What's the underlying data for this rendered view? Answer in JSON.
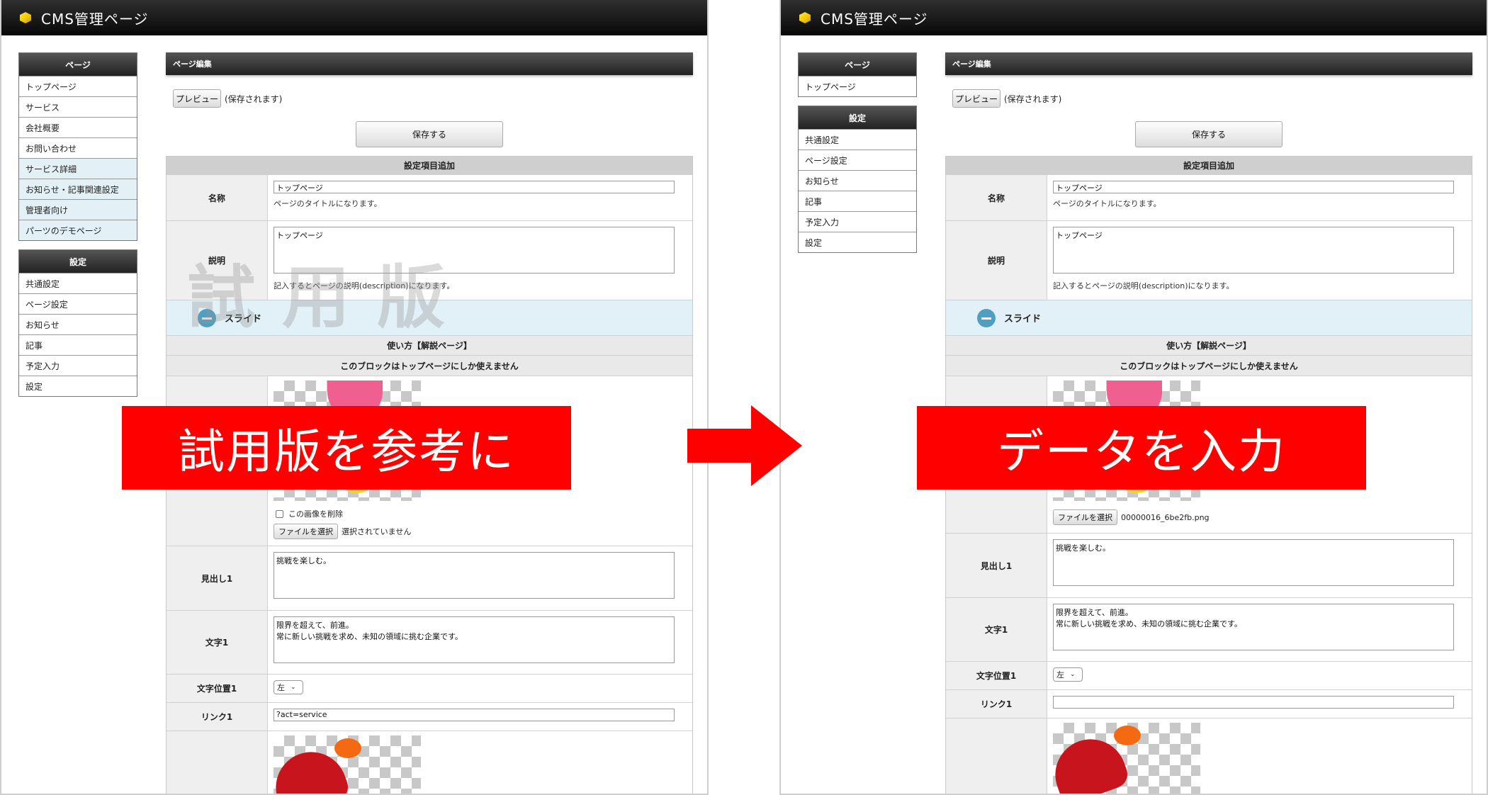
{
  "app_title": "CMS管理ページ",
  "sidebar": {
    "pages_header": "ページ",
    "pages_items_left": [
      "トップページ",
      "サービス",
      "会社概要",
      "お問い合わせ",
      "サービス詳細",
      "お知らせ・記事関連設定",
      "管理者向け",
      "パーツのデモページ"
    ],
    "pages_items_right": [
      "トップページ"
    ],
    "settings_header": "設定",
    "settings_items": [
      "共通設定",
      "ページ設定",
      "お知らせ",
      "記事",
      "予定入力",
      "設定"
    ]
  },
  "main": {
    "header": "ページ編集",
    "preview_button": "プレビュー",
    "preview_note": "(保存されます)",
    "save_button": "保存する",
    "section_title": "設定項目追加",
    "name_label": "名称",
    "name_value": "トップページ",
    "name_help": "ページのタイトルになります。",
    "desc_label": "説明",
    "desc_value": "トップページ",
    "desc_help": "記入するとページの説明(description)になります。",
    "slide_label": "スライド",
    "usage_text": "使い方【解説ページ】",
    "block_note": "このブロックはトップページにしか使えません",
    "delete_image_label": "この画像を削除",
    "file_button": "ファイルを選択",
    "file_status_left": "選択されていません",
    "file_status_right": "00000016_6be2fb.png",
    "heading1_label": "見出し1",
    "heading1_value": "挑戦を楽しむ。",
    "text1_label": "文字1",
    "text1_value": "限界を超えて、前進。\n常に新しい挑戦を求め、未知の領域に挑む企業です。",
    "textpos1_label": "文字位置1",
    "textpos1_value": "左",
    "link1_label": "リンク1",
    "link1_value_left": "?act=service",
    "link1_value_right": ""
  },
  "overlay": {
    "watermark": "試用版",
    "left_banner": "試用版を参考に",
    "right_banner": "データを入力"
  },
  "colors": {
    "banner": "#ff0000",
    "slide_bg": "#e2f1f7",
    "minus_icon": "#4f9fc3",
    "highlight_sidebar": "#e3f1f7"
  }
}
